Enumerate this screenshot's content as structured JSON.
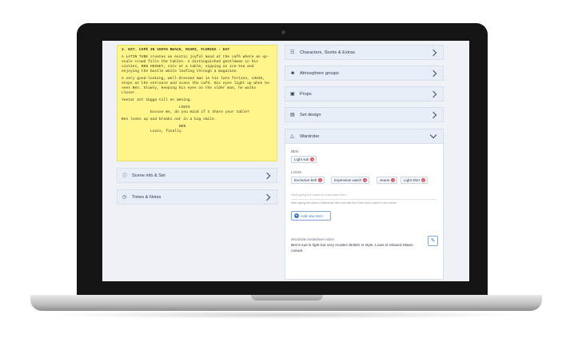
{
  "script": {
    "heading": "2. EXT. CAFÉ IN SOUTH BEACH, MIAMI, FLORIDA - DAY",
    "action_1": "A LATIN TUNE creates an exotic joyful mood at the café where an up-scale crowd fills the tables. A distinguished gentleman in his sixties, BEN HESSEY, sits at a table, sipping an ice-tea and enjoying the bustle while leafing through a magazine.",
    "action_2": "A very good-looking, well-dressed man in his late forties, LOUIS, stops at the entrance and scans the café. His eyes light up when he sees Ben. Slowly, keeping his eyes on the older man, he walks closer.",
    "action_3": "Yeetar att 1bgga till en mening.",
    "character_1": "LOUIS",
    "dialogue_1": "Excuse me, do you mind if I share your table?",
    "action_4": "Ben looks up and breaks out in a big smile.",
    "character_2": "BEN",
    "dialogue_2": "Louis, finally."
  },
  "left_panels": {
    "scene_info": "Scene info & Set",
    "times_notes": "Times & Notes"
  },
  "right_panels": {
    "characters": "Characters, Stunts & Extras",
    "atmosphere": "Atmosphere groups",
    "props": "Props",
    "set_design": "Set design",
    "wardrobe": "Wardrobe"
  },
  "wardrobe": {
    "characters": [
      {
        "name": "BEN",
        "items": [
          "Light suit"
        ]
      },
      {
        "name": "LOUIS",
        "items": [
          "Exclusive belt",
          "Expensive watch",
          "Jeans",
          "Light shirt"
        ]
      }
    ],
    "input_placeholder": "Start typing the name of a wardrobe item...",
    "hint": "Start typing the name a Wardrobe item and use the Enter key to add it to the scene",
    "add_button": "Add new item",
    "notes_label": "Wardrobe breakdown notes",
    "notes_text": "Ben's suit is light but very modern British in style. Louis is relaxed Miami casual."
  },
  "icons": {
    "scene_info": "info-icon",
    "times_notes": "clock-icon",
    "characters": "people-icon",
    "atmosphere": "group-icon",
    "props": "box-icon",
    "set_design": "set-icon",
    "wardrobe": "hanger-icon",
    "edit": "pencil-icon"
  },
  "colors": {
    "script_bg": "#fff58a",
    "panel_bg": "#e8eef7",
    "accent": "#3f78c6",
    "remove": "#e0505a"
  }
}
